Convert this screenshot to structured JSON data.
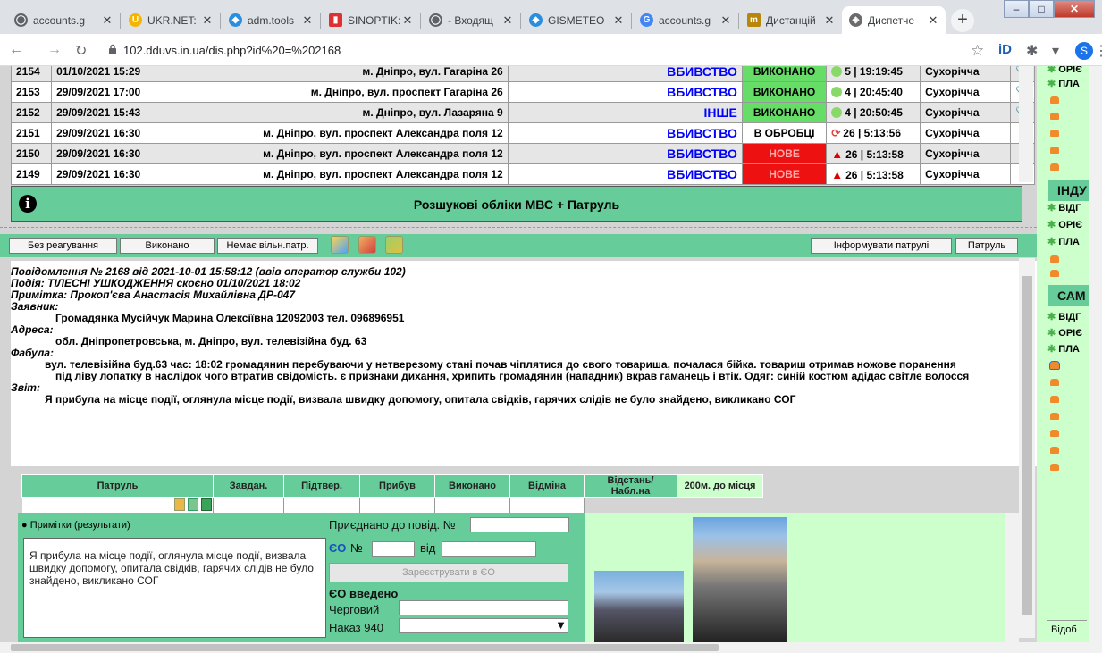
{
  "browser": {
    "tabs": [
      {
        "label": "accounts.g",
        "color": "#5f6368",
        "glyph": "◯"
      },
      {
        "label": "UKR.NET: I",
        "color": "#f5b400",
        "glyph": "U"
      },
      {
        "label": "adm.tools",
        "color": "#2a8ee0",
        "glyph": "◆"
      },
      {
        "label": "SINOPTIK:",
        "color": "#e03030",
        "glyph": "▮"
      },
      {
        "label": "- Входящ",
        "color": "#5f6368",
        "glyph": "◯"
      },
      {
        "label": "GISMETEO",
        "color": "#2a8ee0",
        "glyph": "◆"
      },
      {
        "label": "accounts.g",
        "color": "#4285f4",
        "glyph": "G"
      },
      {
        "label": "Дистанцій",
        "color": "#b8860b",
        "glyph": "m"
      },
      {
        "label": "Диспетче",
        "color": "#6b6b6b",
        "glyph": "◈"
      }
    ],
    "url": "102.dduvs.in.ua/dis.php?id%20=%202168",
    "profile_initial": "S"
  },
  "incidents": [
    {
      "id": "2154",
      "date": "01/10/2021 15:29",
      "address": "м. Дніпро, вул. Гагаріна 26",
      "type": "ВБИВСТВО",
      "status": "ВИКОНАНО",
      "status_kind": "done",
      "mark": "ok",
      "metric": "5 | 19:19:45",
      "officer": "Сухорічча",
      "clip": "📎"
    },
    {
      "id": "2153",
      "date": "29/09/2021 17:00",
      "address": "м. Дніпро, вул. проспект Гагаріна 26",
      "type": "ВБИВСТВО",
      "status": "ВИКОНАНО",
      "status_kind": "done",
      "mark": "ok",
      "metric": "4 | 20:45:40",
      "officer": "Сухорічча",
      "clip": "📎"
    },
    {
      "id": "2152",
      "date": "29/09/2021 15:43",
      "address": "м. Дніпро, вул. Лазаряна 9",
      "type": "ІНШЕ",
      "status": "ВИКОНАНО",
      "status_kind": "done",
      "mark": "ok",
      "metric": "4 | 20:50:45",
      "officer": "Сухорічча",
      "clip": "📎"
    },
    {
      "id": "2151",
      "date": "29/09/2021 16:30",
      "address": "м. Дніпро, вул. проспект Александра поля 12",
      "type": "ВБИВСТВО",
      "status": "В ОБРОБЦІ",
      "status_kind": "proc",
      "mark": "spin",
      "metric": "26 | 5:13:56",
      "officer": "Сухорічча",
      "clip": ""
    },
    {
      "id": "2150",
      "date": "29/09/2021 16:30",
      "address": "м. Дніпро, вул. проспект Александра поля 12",
      "type": "ВБИВСТВО",
      "status": "НОВЕ",
      "status_kind": "new",
      "mark": "warn",
      "metric": "26 | 5:13:58",
      "officer": "Сухорічча",
      "clip": ""
    },
    {
      "id": "2149",
      "date": "29/09/2021 16:30",
      "address": "м. Дніпро, вул. проспект Александра поля 12",
      "type": "ВБИВСТВО",
      "status": "НОВЕ",
      "status_kind": "new",
      "mark": "warn",
      "metric": "26 | 5:13:58",
      "officer": "Сухорічча",
      "clip": ""
    }
  ],
  "banner": {
    "title": "Розшукові обліки МВС + Патруль"
  },
  "buttons": {
    "no_reaction": "Без реагування",
    "done": "Виконано",
    "no_patrol": "Немає вільн.патр.",
    "inform_patrols": "Інформувати патрулі",
    "patrol": "Патруль"
  },
  "message": {
    "header": "Повідомлення № 2168 від 2021-10-01 15:58:12 (ввів оператор служби 102)",
    "event": "Подія: ТІЛЕСНІ УШКОДЖЕННЯ скоєно 01/10/2021 18:02",
    "note": "Примітка: Прокоп'єва Анастасія Михайлівна ДР-047",
    "applicant_label": "Заявник:",
    "applicant": "Громадянка Мусійчук Марина Олексіївна 12092003 тел. 096896951",
    "address_label": "Адреса:",
    "address": "обл. Дніпропетровська, м. Дніпро, вул. телевізійна буд. 63",
    "fabula_label": "Фабула:",
    "fabula_1": "вул. телевізійна буд.63 час: 18:02 громадянин перебуваючи у нетверезому стані почав чіплятися до свого товариша, почалася бійка. товариш отримав ножове поранення",
    "fabula_2": "під ліву лопатку в наслідок чого втратив свідомість. є признаки дихання, хрипить громадянин (нападник) вкрав гаманець і втік. Одяг: синій костюм адідас світле волосся",
    "report_label": "Звіт:",
    "report": "Я прибула на місце події, оглянула місце події, визвала швидку допомогу, опитала свідків, гарячих слідів не було знайдено, викликано СОГ"
  },
  "patrol_table": {
    "headers": [
      "Патруль",
      "Завдан.",
      "Підтвер.",
      "Прибув",
      "Виконано",
      "Відміна",
      "Відстань/Набл.на",
      "200м. до місця"
    ]
  },
  "notes": {
    "title": "Примітки (результати)",
    "text": "Я прибула на місце події, оглянула місце події, визвала швидку допомогу, опитала свідків, гарячих слідів не було знайдено, викликано СОГ"
  },
  "form": {
    "attach_label": "Приєднано до повід. №",
    "eo_label": "ЄО",
    "num_label": "№",
    "from_label": "від",
    "register_button": "Зареєструвати в ЄО",
    "eo_entered": "ЄО введено",
    "duty_label": "Черговий",
    "order_label": "Наказ 940"
  },
  "right_panel": {
    "top_items": [
      "ОРІЄ",
      "ПЛА"
    ],
    "section1": "ІНДУ",
    "section1_items": [
      "ВІДГ",
      "ОРІЄ",
      "ПЛА"
    ],
    "section2": "САМ",
    "section2_items": [
      "ВІДГ",
      "ОРІЄ",
      "ПЛА"
    ],
    "bottom_label": "Відоб"
  }
}
